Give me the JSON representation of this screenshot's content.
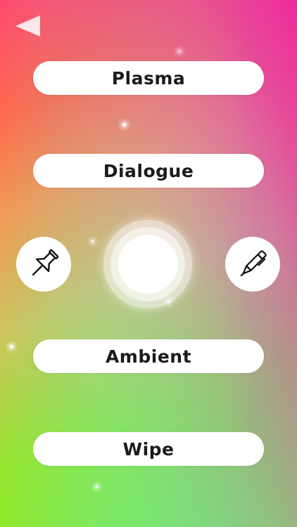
{
  "header": {
    "back_icon": "back-arrow-icon"
  },
  "buttons": [
    {
      "id": "plasma",
      "label": "Plasma"
    },
    {
      "id": "dialogue",
      "label": "Dialogue"
    },
    {
      "id": "ambient",
      "label": "Ambient"
    },
    {
      "id": "wipe",
      "label": "Wipe"
    }
  ],
  "side_controls": {
    "left_icon": "pushpin-icon",
    "right_icon": "pen-icon"
  },
  "center_control": {
    "icon": "record-circle"
  },
  "colors": {
    "button_bg": "#ffffff",
    "button_text": "#1b1b1b",
    "gradient_pink": "#ff3c78",
    "gradient_magenta": "#ee28a0",
    "gradient_orange": "#ff8c45",
    "gradient_lime": "#8af12a",
    "gradient_cyan": "#5af0e6"
  }
}
